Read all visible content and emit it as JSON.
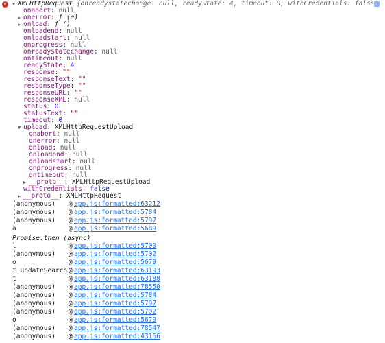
{
  "header": {
    "title": "XMLHttpRequest",
    "preview": "{onreadystatechange: null, readyState: 4, timeout: 0, withCredentials: false, upload: XMLHttpRequestUpload, …}",
    "info_glyph": "i"
  },
  "props": [
    {
      "indent": 1,
      "tri": "",
      "key": "onabort",
      "sep": ": ",
      "val": "null",
      "type": "null"
    },
    {
      "indent": 1,
      "tri": "▶",
      "key": "onerror",
      "sep": ": ",
      "val": "ƒ (e)",
      "type": "fn"
    },
    {
      "indent": 1,
      "tri": "▶",
      "key": "onload",
      "sep": ": ",
      "val": "ƒ ()",
      "type": "fn"
    },
    {
      "indent": 1,
      "tri": "",
      "key": "onloadend",
      "sep": ": ",
      "val": "null",
      "type": "null"
    },
    {
      "indent": 1,
      "tri": "",
      "key": "onloadstart",
      "sep": ": ",
      "val": "null",
      "type": "null"
    },
    {
      "indent": 1,
      "tri": "",
      "key": "onprogress",
      "sep": ": ",
      "val": "null",
      "type": "null"
    },
    {
      "indent": 1,
      "tri": "",
      "key": "onreadystatechange",
      "sep": ": ",
      "val": "null",
      "type": "null"
    },
    {
      "indent": 1,
      "tri": "",
      "key": "ontimeout",
      "sep": ": ",
      "val": "null",
      "type": "null"
    },
    {
      "indent": 1,
      "tri": "",
      "key": "readyState",
      "sep": ": ",
      "val": "4",
      "type": "num"
    },
    {
      "indent": 1,
      "tri": "",
      "key": "response",
      "sep": ": ",
      "val": "\"\"",
      "type": "str"
    },
    {
      "indent": 1,
      "tri": "",
      "key": "responseText",
      "sep": ": ",
      "val": "\"\"",
      "type": "str"
    },
    {
      "indent": 1,
      "tri": "",
      "key": "responseType",
      "sep": ": ",
      "val": "\"\"",
      "type": "str"
    },
    {
      "indent": 1,
      "tri": "",
      "key": "responseURL",
      "sep": ": ",
      "val": "\"\"",
      "type": "str"
    },
    {
      "indent": 1,
      "tri": "",
      "key": "responseXML",
      "sep": ": ",
      "val": "null",
      "type": "null"
    },
    {
      "indent": 1,
      "tri": "",
      "key": "status",
      "sep": ": ",
      "val": "0",
      "type": "num"
    },
    {
      "indent": 1,
      "tri": "",
      "key": "statusText",
      "sep": ": ",
      "val": "\"\"",
      "type": "str"
    },
    {
      "indent": 1,
      "tri": "",
      "key": "timeout",
      "sep": ": ",
      "val": "0",
      "type": "num"
    },
    {
      "indent": 1,
      "tri": "▼",
      "key": "upload",
      "sep": ": ",
      "val": "XMLHttpRequestUpload",
      "type": "obj"
    },
    {
      "indent": 2,
      "tri": "",
      "key": "onabort",
      "sep": ": ",
      "val": "null",
      "type": "null"
    },
    {
      "indent": 2,
      "tri": "",
      "key": "onerror",
      "sep": ": ",
      "val": "null",
      "type": "null"
    },
    {
      "indent": 2,
      "tri": "",
      "key": "onload",
      "sep": ": ",
      "val": "null",
      "type": "null"
    },
    {
      "indent": 2,
      "tri": "",
      "key": "onloadend",
      "sep": ": ",
      "val": "null",
      "type": "null"
    },
    {
      "indent": 2,
      "tri": "",
      "key": "onloadstart",
      "sep": ": ",
      "val": "null",
      "type": "null"
    },
    {
      "indent": 2,
      "tri": "",
      "key": "onprogress",
      "sep": ": ",
      "val": "null",
      "type": "null"
    },
    {
      "indent": 2,
      "tri": "",
      "key": "ontimeout",
      "sep": ": ",
      "val": "null",
      "type": "null"
    },
    {
      "indent": 2,
      "tri": "▶",
      "key": "__proto__",
      "sep": ": ",
      "val": "XMLHttpRequestUpload",
      "type": "obj"
    },
    {
      "indent": 1,
      "tri": "",
      "key": "withCredentials",
      "sep": ": ",
      "val": "false",
      "type": "kw"
    },
    {
      "indent": 1,
      "tri": "▶",
      "key": "__proto__",
      "sep": ": ",
      "val": "XMLHttpRequest",
      "type": "obj"
    }
  ],
  "stack_a": [
    {
      "name": "(anonymous)",
      "at": "@",
      "link": "app.js:formatted:63212"
    },
    {
      "name": "(anonymous)",
      "at": "@",
      "link": "app.js:formatted:5784"
    },
    {
      "name": "(anonymous)",
      "at": "@",
      "link": "app.js:formatted:5797"
    },
    {
      "name": "a",
      "at": "@",
      "link": "app.js:formatted:5689"
    }
  ],
  "async_label": "Promise.then (async)",
  "stack_b": [
    {
      "name": "l",
      "at": "@",
      "link": "app.js:formatted:5700"
    },
    {
      "name": "(anonymous)",
      "at": "@",
      "link": "app.js:formatted:5702"
    },
    {
      "name": "o",
      "at": "@",
      "link": "app.js:formatted:5679"
    },
    {
      "name": "t.updateSearch",
      "at": "@",
      "link": "app.js:formatted:63193"
    },
    {
      "name": "t",
      "at": "@",
      "link": "app.js:formatted:63188"
    },
    {
      "name": "(anonymous)",
      "at": "@",
      "link": "app.js:formatted:78550"
    },
    {
      "name": "(anonymous)",
      "at": "@",
      "link": "app.js:formatted:5784"
    },
    {
      "name": "(anonymous)",
      "at": "@",
      "link": "app.js:formatted:5797"
    },
    {
      "name": "(anonymous)",
      "at": "@",
      "link": "app.js:formatted:5702"
    },
    {
      "name": "o",
      "at": "@",
      "link": "app.js:formatted:5679"
    },
    {
      "name": "(anonymous)",
      "at": "@",
      "link": "app.js:formatted:78547"
    },
    {
      "name": "(anonymous)",
      "at": "@",
      "link": "app.js:formatted:43166"
    }
  ]
}
